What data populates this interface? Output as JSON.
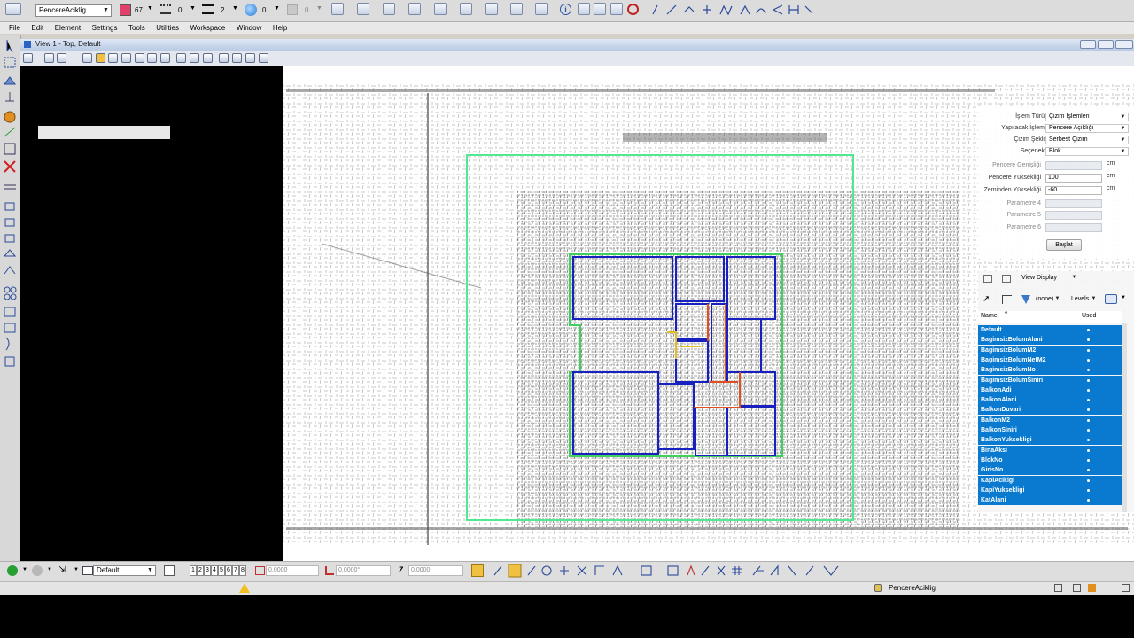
{
  "toolbar": {
    "element_template": "PencereAciklig",
    "color_value": "67",
    "line_style_value": "0",
    "weight_value": "2",
    "transparency_value": "0",
    "priority_value": "0"
  },
  "menu": {
    "items": [
      "File",
      "Edit",
      "Element",
      "Settings",
      "Tools",
      "Utilities",
      "Workspace",
      "Window",
      "Help"
    ]
  },
  "view": {
    "title": "View 1 - Top, Default"
  },
  "panel": {
    "rows": [
      {
        "label": "İşlem Türü",
        "value": "Çizim İşlemleri"
      },
      {
        "label": "Yapılacak İşlem",
        "value": "Pencere Açıklığı"
      },
      {
        "label": "Çizim Şekli",
        "value": "Serbest Çizim"
      },
      {
        "label": "Seçenek",
        "value": "Blok"
      }
    ],
    "params": [
      {
        "label": "Pencere Genişliği",
        "value": "",
        "unit": "cm"
      },
      {
        "label": "Pencere Yüksekliği",
        "value": "100",
        "unit": "cm"
      },
      {
        "label": "Zeminden Yüksekliği",
        "value": "-60",
        "unit": "cm"
      },
      {
        "label": "Parametre 4",
        "value": "",
        "unit": ""
      },
      {
        "label": "Parametre 5",
        "value": "",
        "unit": ""
      },
      {
        "label": "Parametre 6",
        "value": "",
        "unit": ""
      }
    ],
    "start_button": "Başlat"
  },
  "levels": {
    "view_display": "View Display",
    "filter": "(none)",
    "mode": "Levels",
    "col_name": "Name",
    "col_used": "Used",
    "items": [
      "Default",
      "BagimsizBolumAlani",
      "BagimsizBolumM2",
      "BagimsizBolumNetM2",
      "BagimsizBolumNo",
      "BagimsizBolumSiniri",
      "BalkonAdi",
      "BalkonAlani",
      "BalkonDuvari",
      "BalkonM2",
      "BalkonSiniri",
      "BalkonYuksekligi",
      "BinaAksi",
      "BlokNo",
      "GirisNo",
      "KapiAciklgi",
      "KapiYuksekligi",
      "KatAlani"
    ]
  },
  "bottom": {
    "active_level": "Default",
    "view_numbers": [
      "1",
      "2",
      "3",
      "4",
      "5",
      "6",
      "7",
      "8"
    ],
    "x_value": "0.0000",
    "angle_value": "0.0000°",
    "z_label": "Z",
    "z_value": "0.0000"
  },
  "status": {
    "level_name": "PencereAciklig"
  }
}
